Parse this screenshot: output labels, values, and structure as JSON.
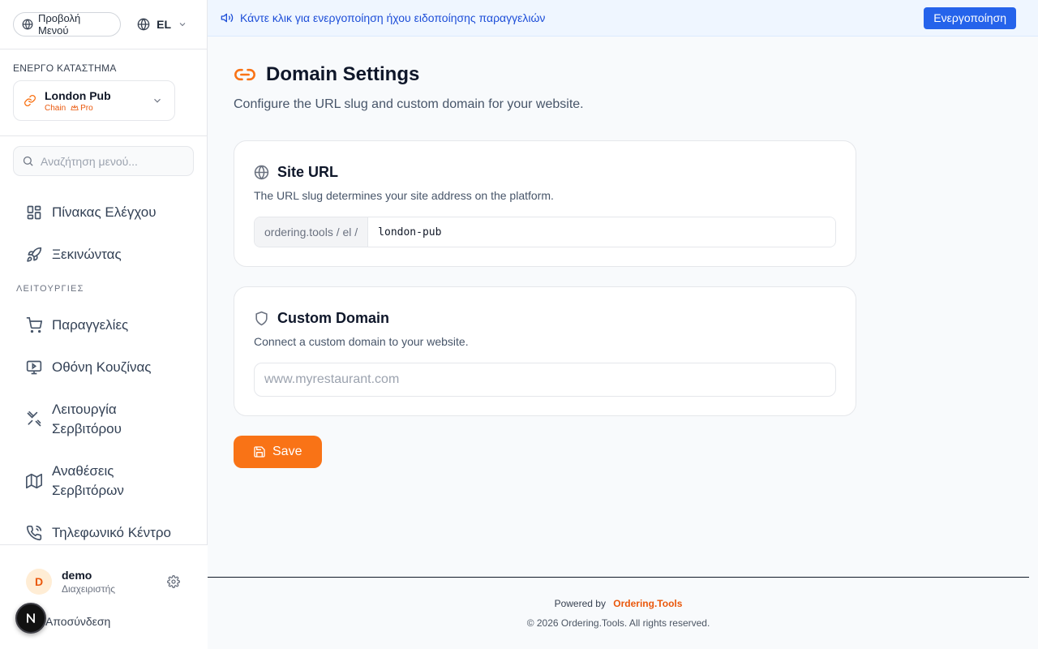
{
  "sidebar": {
    "view_menu_label": "Προβολή Μενού",
    "language": "EL",
    "store_caption": "ΕΝΕΡΓΟ ΚΑΤΑΣΤΗΜΑ",
    "store_name": "London Pub",
    "store_type": "Chain",
    "store_plan": "Pro",
    "search_placeholder": "Αναζήτηση μενού...",
    "nav_top": [
      {
        "label": "Πίνακας Ελέγχου",
        "icon": "dashboard-icon"
      },
      {
        "label": "Ξεκινώντας",
        "icon": "rocket-icon"
      }
    ],
    "section_label": "ΛΕΙΤΟΥΡΓΙΕΣ",
    "nav_ops": [
      {
        "label": "Παραγγελίες",
        "icon": "cart-icon"
      },
      {
        "label": "Οθόνη Κουζίνας",
        "icon": "monitor-icon"
      },
      {
        "label_line1": "Λειτουργία",
        "label_line2": "Σερβιτόρου",
        "icon": "utensils-icon"
      },
      {
        "label_line1": "Αναθέσεις",
        "label_line2": "Σερβιτόρων",
        "icon": "map-icon"
      },
      {
        "label": "Τηλεφωνικό Κέντρο",
        "icon": "phone-icon"
      }
    ],
    "user": {
      "initial": "D",
      "name": "demo",
      "role": "Διαχειριστής"
    },
    "logout_label": "Αποσύνδεση",
    "badge_letter": "N"
  },
  "banner": {
    "text": "Κάντε κλικ για ενεργοποίηση ήχου ειδοποίησης παραγγελιών",
    "button_label": "Ενεργοποίηση"
  },
  "main": {
    "title": "Domain Settings",
    "description": "Configure the URL slug and custom domain for your website.",
    "site_url": {
      "title": "Site URL",
      "description": "The URL slug determines your site address on the platform.",
      "prefix": "ordering.tools / el /",
      "slug_value": "london-pub"
    },
    "custom_domain": {
      "title": "Custom Domain",
      "description": "Connect a custom domain to your website.",
      "placeholder": "www.myrestaurant.com"
    },
    "save_label": "Save"
  },
  "footer": {
    "powered_by": "Powered by",
    "brand": "Ordering.Tools",
    "copyright": "© 2026 Ordering.Tools. All rights reserved."
  },
  "colors": {
    "accent": "#f97316",
    "banner_bg": "#eff6ff",
    "banner_button": "#2563eb"
  }
}
